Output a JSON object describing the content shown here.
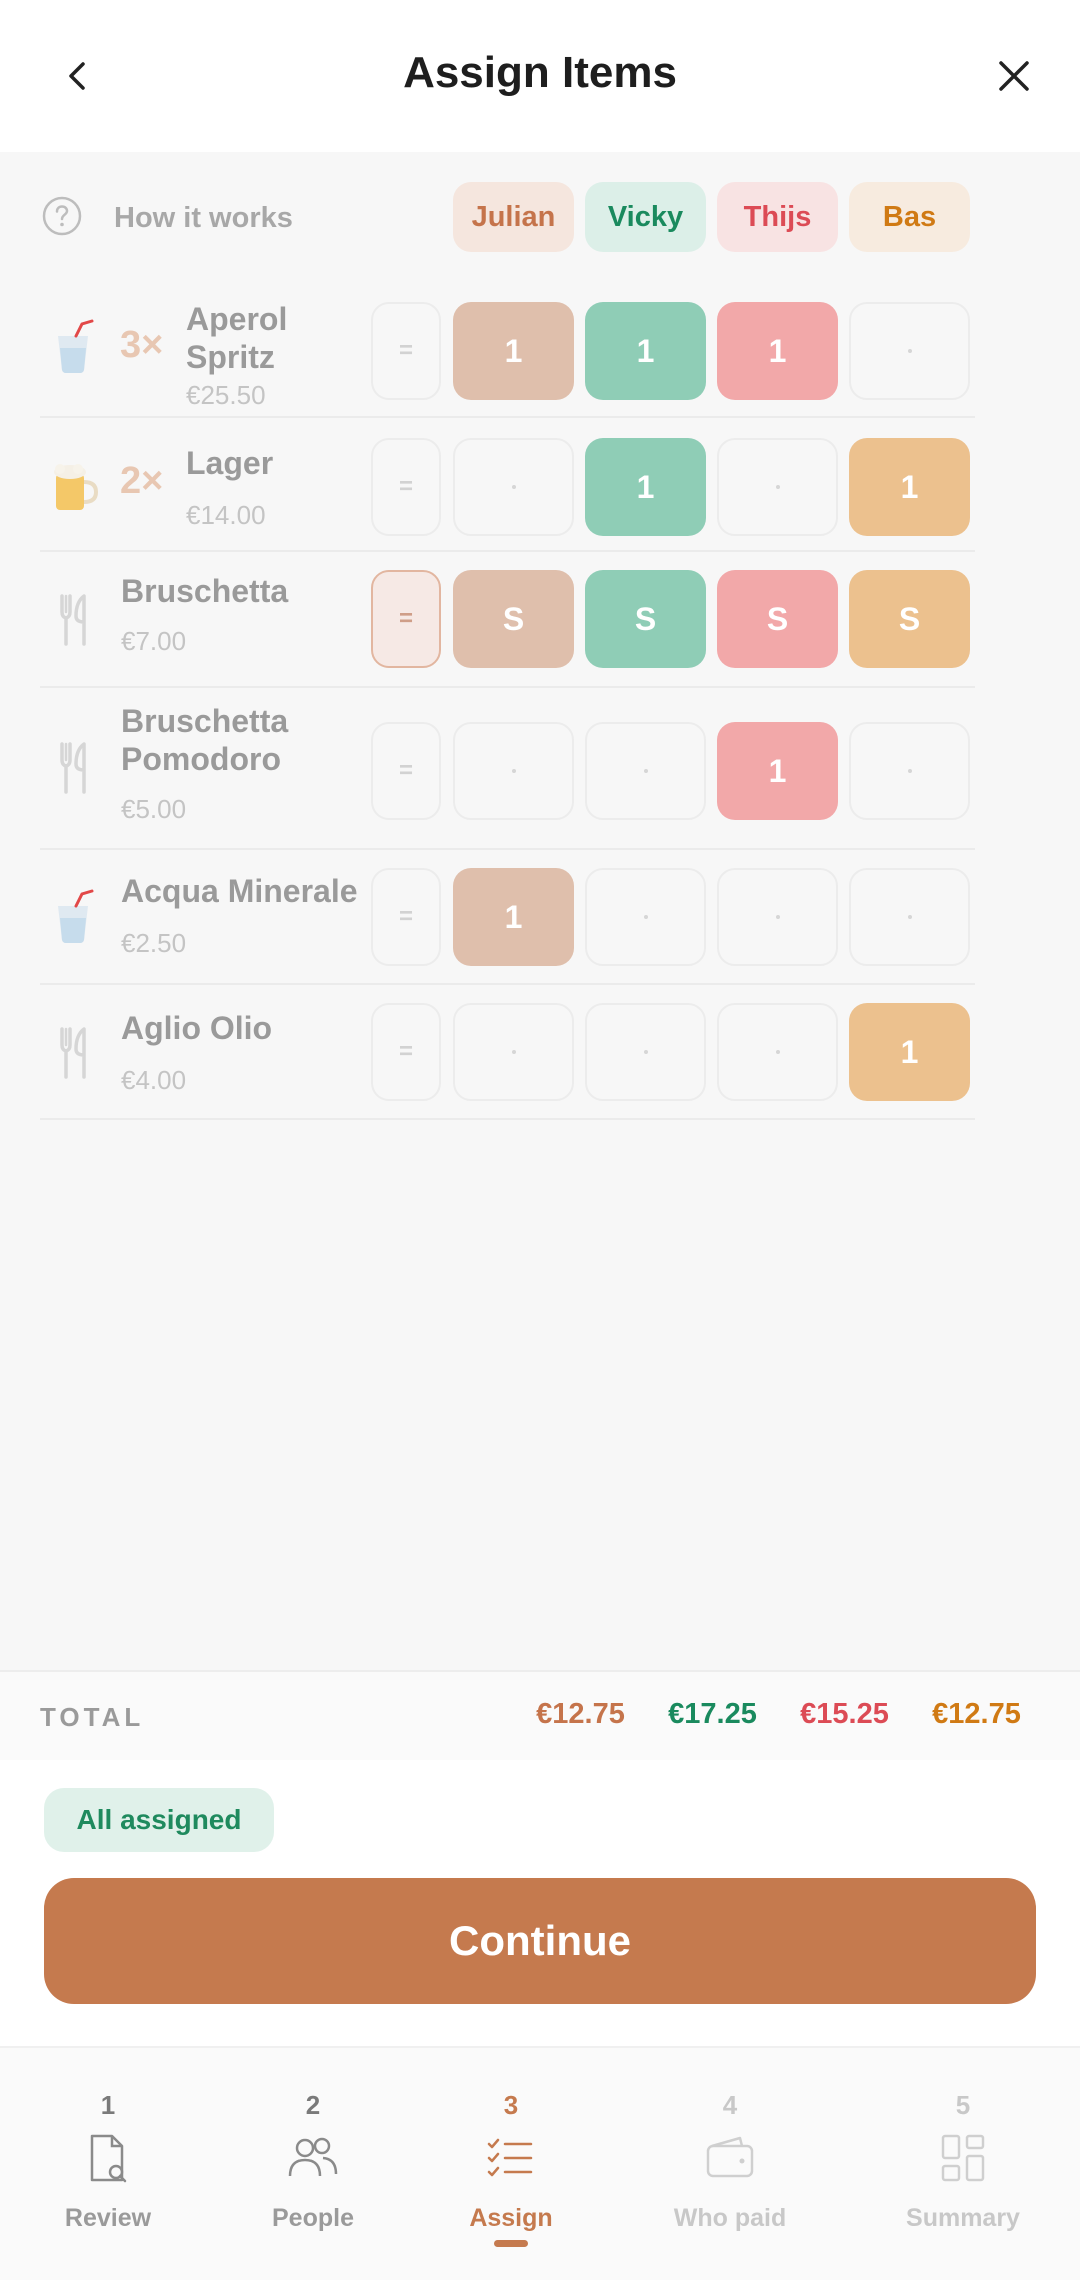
{
  "header": {
    "title": "Assign Items"
  },
  "how_it_works": "How it works",
  "people": [
    {
      "name": "Julian",
      "text_color": "#c5744b",
      "chip_bg": "#f5e6de",
      "cell_bg": "#dfbfac"
    },
    {
      "name": "Vicky",
      "text_color": "#1a8a5e",
      "chip_bg": "#dcefe8",
      "cell_bg": "#8fcdb6"
    },
    {
      "name": "Thijs",
      "text_color": "#dc4b55",
      "chip_bg": "#f8e3e3",
      "cell_bg": "#f2a8a9"
    },
    {
      "name": "Bas",
      "text_color": "#d07a14",
      "chip_bg": "#f7ebdf",
      "cell_bg": "#ecc18e"
    }
  ],
  "items": [
    {
      "icon": "drink-icon",
      "qty": "3×",
      "name": "Aperol Spritz",
      "price": "€25.50",
      "equal": false,
      "assign": [
        "1",
        "1",
        "1",
        "·"
      ]
    },
    {
      "icon": "beer-icon",
      "qty": "2×",
      "name": "Lager",
      "price": "€14.00",
      "equal": false,
      "assign": [
        "·",
        "1",
        "·",
        "1"
      ]
    },
    {
      "icon": "cutlery-icon",
      "qty": "",
      "name": "Bruschetta",
      "price": "€7.00",
      "equal": true,
      "assign": [
        "S",
        "S",
        "S",
        "S"
      ]
    },
    {
      "icon": "cutlery-icon",
      "qty": "",
      "name": "Bruschetta Pomodoro",
      "price": "€5.00",
      "equal": false,
      "assign": [
        "·",
        "·",
        "1",
        "·"
      ]
    },
    {
      "icon": "drink-icon",
      "qty": "",
      "name": "Acqua Minerale",
      "price": "€2.50",
      "equal": false,
      "assign": [
        "1",
        "·",
        "·",
        "·"
      ]
    },
    {
      "icon": "cutlery-icon",
      "qty": "",
      "name": "Aglio Olio",
      "price": "€4.00",
      "equal": false,
      "assign": [
        "·",
        "·",
        "·",
        "1"
      ]
    }
  ],
  "equal_symbol": "=",
  "totals": {
    "label": "TOTAL",
    "values": [
      "€12.75",
      "€17.25",
      "€15.25",
      "€12.75"
    ]
  },
  "status_badge": "All assigned",
  "continue_label": "Continue",
  "nav": [
    {
      "num": "1",
      "label": "Review",
      "icon": "receipt-search-icon",
      "active": false,
      "enabled": true
    },
    {
      "num": "2",
      "label": "People",
      "icon": "people-icon",
      "active": false,
      "enabled": true
    },
    {
      "num": "3",
      "label": "Assign",
      "icon": "checklist-icon",
      "active": true,
      "enabled": true
    },
    {
      "num": "4",
      "label": "Who paid",
      "icon": "wallet-icon",
      "active": false,
      "enabled": false
    },
    {
      "num": "5",
      "label": "Summary",
      "icon": "grid-icon",
      "active": false,
      "enabled": false
    }
  ],
  "colors": {
    "accent": "#c57a4e",
    "success": "#1f8a5e"
  }
}
